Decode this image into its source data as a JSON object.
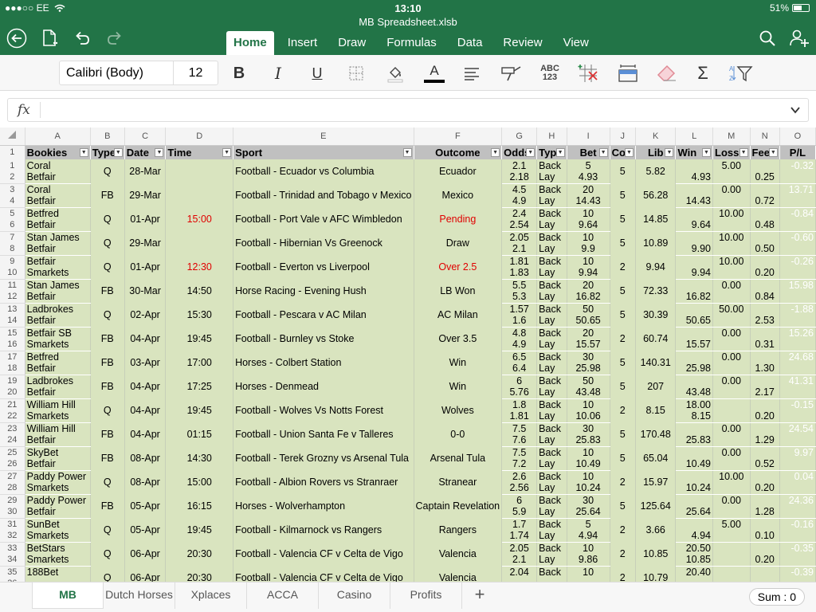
{
  "status": {
    "carrier": "●●●○○ EE",
    "time": "13:10",
    "battery": "51%"
  },
  "file_title": "MB Spreadsheet.xlsb",
  "tabs": [
    "Home",
    "Insert",
    "Draw",
    "Formulas",
    "Data",
    "Review",
    "View"
  ],
  "font": {
    "name": "Calibri (Body)",
    "size": "12"
  },
  "ribbon": {
    "bold": "B",
    "italic": "I",
    "underline": "U",
    "font_color": "A",
    "numfmt": "ABC\n123",
    "sum": "Σ"
  },
  "formula": {
    "label": "fx",
    "value": ""
  },
  "columns": [
    "A",
    "B",
    "C",
    "D",
    "E",
    "F",
    "G",
    "H",
    "I",
    "J",
    "K",
    "L",
    "M",
    "N",
    "O"
  ],
  "headers": [
    "Bookies",
    "Type",
    "Date",
    "Time",
    "Sport",
    "Outcome",
    "Odds",
    "Typ",
    "Bet",
    "Cor",
    "Lib",
    "Win",
    "Loss",
    "Fee",
    "P/L"
  ],
  "rows": [
    [
      "1",
      [
        "Coral",
        "Betfair"
      ],
      "Q",
      "28-Mar",
      "",
      "Football - Ecuador vs Columbia",
      "Ecuador",
      [
        "2.1",
        "2.18"
      ],
      [
        "Back",
        "Lay"
      ],
      [
        "5",
        "4.93"
      ],
      "5",
      "5.82",
      [
        "",
        "4.93"
      ],
      [
        "5.00",
        ""
      ],
      [
        "",
        "0.25"
      ],
      "-0.32",
      ""
    ],
    [
      "3",
      [
        "Coral",
        "Betfair"
      ],
      "FB",
      "29-Mar",
      "",
      "Football - Trinidad and Tobago v Mexico",
      "Mexico",
      [
        "4.5",
        "4.9"
      ],
      [
        "Back",
        "Lay"
      ],
      [
        "20",
        "14.43"
      ],
      "5",
      "56.28",
      [
        "",
        "14.43"
      ],
      [
        "0.00",
        ""
      ],
      [
        "",
        "0.72"
      ],
      "13.71",
      ""
    ],
    [
      "5",
      [
        "Betfred",
        "Betfair"
      ],
      "Q",
      "01-Apr",
      "15:00",
      "Football - Port Vale v AFC Wimbledon",
      "Pending",
      [
        "2.4",
        "2.54"
      ],
      [
        "Back",
        "Lay"
      ],
      [
        "10",
        "9.64"
      ],
      "5",
      "14.85",
      [
        "",
        "9.64"
      ],
      [
        "10.00",
        ""
      ],
      [
        "",
        "0.48"
      ],
      "-0.84",
      "red"
    ],
    [
      "7",
      [
        "Stan James",
        "Betfair"
      ],
      "Q",
      "29-Mar",
      "",
      "Football - Hibernian Vs Greenock",
      "Draw",
      [
        "2.05",
        "2.1"
      ],
      [
        "Back",
        "Lay"
      ],
      [
        "10",
        "9.9"
      ],
      "5",
      "10.89",
      [
        "",
        "9.90"
      ],
      [
        "10.00",
        ""
      ],
      [
        "",
        "0.50"
      ],
      "-0.60",
      ""
    ],
    [
      "9",
      [
        "Betfair",
        "Smarkets"
      ],
      "Q",
      "01-Apr",
      "12:30",
      "Football - Everton vs Liverpool",
      "Over 2.5",
      [
        "1.81",
        "1.83"
      ],
      [
        "Back",
        "Lay"
      ],
      [
        "10",
        "9.94"
      ],
      "2",
      "9.94",
      [
        "",
        "9.94"
      ],
      [
        "10.00",
        ""
      ],
      [
        "",
        "0.20"
      ],
      "-0.26",
      "red"
    ],
    [
      "11",
      [
        "Stan James",
        "Betfair"
      ],
      "FB",
      "30-Mar",
      "14:50",
      "Horse Racing - Evening Hush",
      "LB Won",
      [
        "5.5",
        "5.3"
      ],
      [
        "Back",
        "Lay"
      ],
      [
        "20",
        "16.82"
      ],
      "5",
      "72.33",
      [
        "",
        "16.82"
      ],
      [
        "0.00",
        ""
      ],
      [
        "",
        "0.84"
      ],
      "15.98",
      ""
    ],
    [
      "13",
      [
        "Ladbrokes",
        "Betfair"
      ],
      "Q",
      "02-Apr",
      "15:30",
      "Football - Pescara v AC Milan",
      "AC Milan",
      [
        "1.57",
        "1.6"
      ],
      [
        "Back",
        "Lay"
      ],
      [
        "50",
        "50.65"
      ],
      "5",
      "30.39",
      [
        "",
        "50.65"
      ],
      [
        "50.00",
        ""
      ],
      [
        "",
        "2.53"
      ],
      "-1.88",
      ""
    ],
    [
      "15",
      [
        "Betfair SB",
        "Smarkets"
      ],
      "FB",
      "04-Apr",
      "19:45",
      "Football - Burnley vs Stoke",
      "Over 3.5",
      [
        "4.8",
        "4.9"
      ],
      [
        "Back",
        "Lay"
      ],
      [
        "20",
        "15.57"
      ],
      "2",
      "60.74",
      [
        "",
        "15.57"
      ],
      [
        "0.00",
        ""
      ],
      [
        "",
        "0.31"
      ],
      "15.26",
      ""
    ],
    [
      "17",
      [
        "Betfred",
        "Betfair"
      ],
      "FB",
      "03-Apr",
      "17:00",
      "Horses - Colbert Station",
      "Win",
      [
        "6.5",
        "6.4"
      ],
      [
        "Back",
        "Lay"
      ],
      [
        "30",
        "25.98"
      ],
      "5",
      "140.31",
      [
        "",
        "25.98"
      ],
      [
        "0.00",
        ""
      ],
      [
        "",
        "1.30"
      ],
      "24.68",
      ""
    ],
    [
      "19",
      [
        "Ladbrokes",
        "Betfair"
      ],
      "FB",
      "04-Apr",
      "17:25",
      "Horses - Denmead",
      "Win",
      [
        "6",
        "5.76"
      ],
      [
        "Back",
        "Lay"
      ],
      [
        "50",
        "43.48"
      ],
      "5",
      "207",
      [
        "",
        "43.48"
      ],
      [
        "0.00",
        ""
      ],
      [
        "",
        "2.17"
      ],
      "41.31",
      ""
    ],
    [
      "21",
      [
        "William Hill",
        "Smarkets"
      ],
      "Q",
      "04-Apr",
      "19:45",
      "Football - Wolves Vs Notts Forest",
      "Wolves",
      [
        "1.8",
        "1.81"
      ],
      [
        "Back",
        "Lay"
      ],
      [
        "10",
        "10.06"
      ],
      "2",
      "8.15",
      [
        "18.00",
        "8.15"
      ],
      [
        "",
        ""
      ],
      [
        "",
        "0.20"
      ],
      "-0.15",
      ""
    ],
    [
      "23",
      [
        "William Hill",
        "Betfair"
      ],
      "FB",
      "04-Apr",
      "01:15",
      "Football - Union Santa Fe v Talleres",
      "0-0",
      [
        "7.5",
        "7.6"
      ],
      [
        "Back",
        "Lay"
      ],
      [
        "30",
        "25.83"
      ],
      "5",
      "170.48",
      [
        "",
        "25.83"
      ],
      [
        "0.00",
        ""
      ],
      [
        "",
        "1.29"
      ],
      "24.54",
      ""
    ],
    [
      "25",
      [
        "SkyBet",
        "Betfair"
      ],
      "FB",
      "08-Apr",
      "14:30",
      "Football - Terek Grozny vs Arsenal Tula",
      "Arsenal Tula",
      [
        "7.5",
        "7.2"
      ],
      [
        "Back",
        "Lay"
      ],
      [
        "10",
        "10.49"
      ],
      "5",
      "65.04",
      [
        "",
        "10.49"
      ],
      [
        "0.00",
        ""
      ],
      [
        "",
        "0.52"
      ],
      "9.97",
      ""
    ],
    [
      "27",
      [
        "Paddy Power",
        "Smarkets"
      ],
      "Q",
      "08-Apr",
      "15:00",
      "Football - Albion Rovers vs Stranraer",
      "Stranear",
      [
        "2.6",
        "2.56"
      ],
      [
        "Back",
        "Lay"
      ],
      [
        "10",
        "10.24"
      ],
      "2",
      "15.97",
      [
        "",
        "10.24"
      ],
      [
        "10.00",
        ""
      ],
      [
        "",
        "0.20"
      ],
      "0.04",
      ""
    ],
    [
      "29",
      [
        "Paddy Power",
        "Betfair"
      ],
      "FB",
      "05-Apr",
      "16:15",
      "Horses - Wolverhampton",
      "Captain Revelation",
      [
        "6",
        "5.9"
      ],
      [
        "Back",
        "Lay"
      ],
      [
        "30",
        "25.64"
      ],
      "5",
      "125.64",
      [
        "",
        "25.64"
      ],
      [
        "0.00",
        ""
      ],
      [
        "",
        "1.28"
      ],
      "24.36",
      ""
    ],
    [
      "31",
      [
        "SunBet",
        "Smarkets"
      ],
      "Q",
      "05-Apr",
      "19:45",
      "Football - Kilmarnock vs Rangers",
      "Rangers",
      [
        "1.7",
        "1.74"
      ],
      [
        "Back",
        "Lay"
      ],
      [
        "5",
        "4.94"
      ],
      "2",
      "3.66",
      [
        "",
        "4.94"
      ],
      [
        "5.00",
        ""
      ],
      [
        "",
        "0.10"
      ],
      "-0.16",
      ""
    ],
    [
      "33",
      [
        "BetStars",
        "Smarkets"
      ],
      "Q",
      "06-Apr",
      "20:30",
      "Football - Valencia CF v Celta de Vigo",
      "Valencia",
      [
        "2.05",
        "2.1"
      ],
      [
        "Back",
        "Lay"
      ],
      [
        "10",
        "9.86"
      ],
      "2",
      "10.85",
      [
        "20.50",
        "10.85"
      ],
      [
        "",
        ""
      ],
      [
        "",
        "0.20"
      ],
      "-0.35",
      ""
    ],
    [
      "35",
      [
        "188Bet",
        ""
      ],
      "Q",
      "06-Apr",
      "20:30",
      "Football - Valencia CF v Celta de Vigo",
      "Valencia",
      [
        "2.04",
        ""
      ],
      [
        "Back",
        ""
      ],
      [
        "10",
        ""
      ],
      "2",
      "10.79",
      [
        "20.40",
        ""
      ],
      [
        "",
        ""
      ],
      [
        "",
        ""
      ],
      "-0.39",
      ""
    ]
  ],
  "sheets": [
    "MB",
    "Dutch Horses",
    "Xplaces",
    "ACCA",
    "Casino",
    "Profits"
  ],
  "add_sheet": "+",
  "sum": "Sum : 0",
  "colors": {
    "accent": "#227447",
    "row_fill": "#d9e4bf",
    "header_fill": "#c0c0c0",
    "highlight": "#e00000"
  }
}
